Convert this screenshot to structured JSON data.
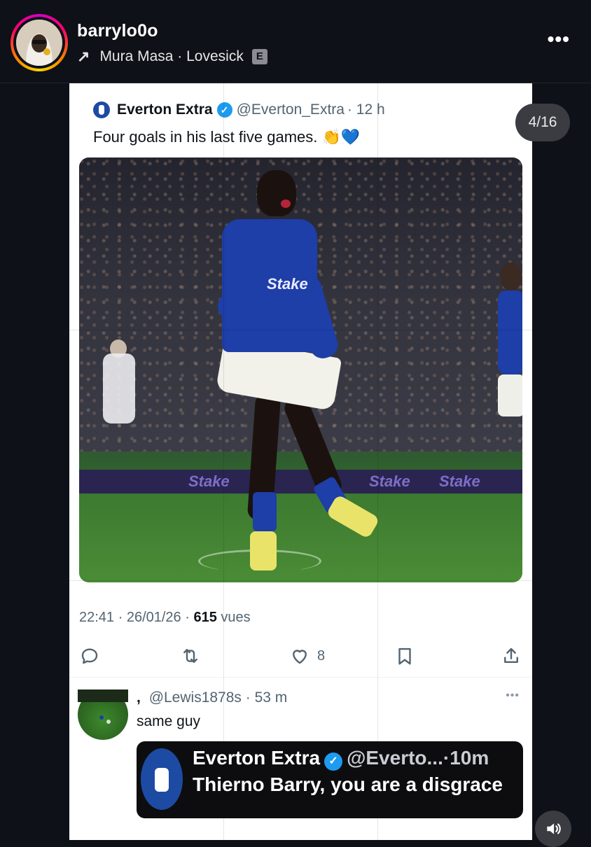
{
  "header": {
    "username": "barrylo0o",
    "music_arrow": "↗",
    "music_track": "Mura Masa · Lovesick",
    "explicit_badge": "E",
    "more_menu": "•••",
    "avatar_icon": "profile-avatar"
  },
  "counter": "4/16",
  "tweet": {
    "author_name": "Everton Extra",
    "author_handle": "@Everton_Extra",
    "time_ago": "· 12 h",
    "text": "Four goals in his last five games.",
    "emoji_clap": "👏",
    "emoji_heart": "💙",
    "photo": {
      "adboard_text": "Stake"
    },
    "timestamp": "22:41 · 26/01/26 ·",
    "views_count": "615",
    "views_label": "vues",
    "likes": "8"
  },
  "reply": {
    "comma": ",",
    "handle": "@Lewis1878s",
    "time_ago": "· 53 m",
    "more": "•••",
    "text": "same guy",
    "quote": {
      "author_name": "Everton Extra",
      "author_handle": "@Everto...",
      "time_ago": "·10m",
      "text": "Thierno Barry, you are a disgrace"
    }
  },
  "colors": {
    "background": "#0f1118",
    "everton_blue": "#1d4ba3",
    "verified_blue": "#1d9bf0",
    "muted_text": "#536471"
  }
}
